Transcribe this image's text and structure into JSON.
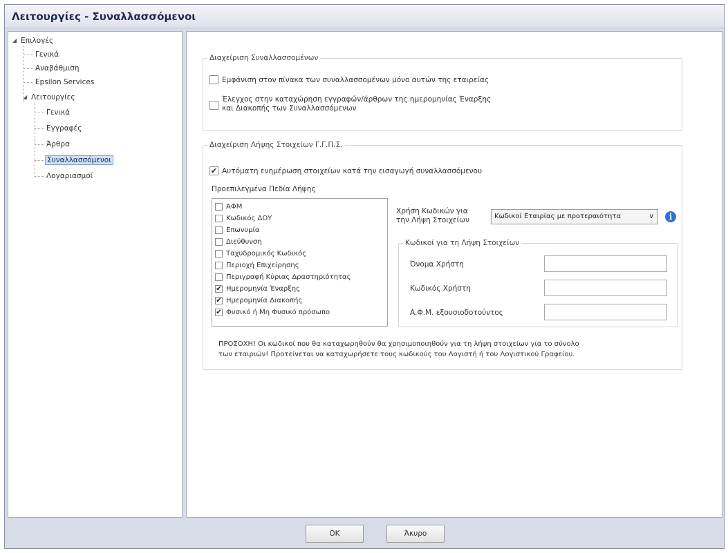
{
  "window": {
    "title": "Λειτουργίες - Συναλλασσόμενοι"
  },
  "tree": {
    "root": "Επιλογές",
    "items": [
      "Γενικά",
      "Αναβάθμιση",
      "Epsilon Services"
    ],
    "functions": "Λειτουργίες",
    "sub_items": [
      "Γενικά",
      "Εγγραφές",
      "Άρθρα",
      "Συναλλασσόμενοι",
      "Λογαριασμοί"
    ]
  },
  "group1": {
    "legend": "Διαχείριση Συναλλασσομένων",
    "options": [
      {
        "label": "Εμφάνιση στον πίνακα των συναλλασσομένων μόνο αυτών της εταιρείας",
        "checked": false
      },
      {
        "label_line1": "Έλεγχος στην καταχώρηση εγγραφών/άρθρων της ημερομηνίας Έναρξης",
        "label_line2": "και Διακοπής των Συναλλασσόμενων",
        "checked": false
      }
    ]
  },
  "group2": {
    "legend": "Διαχείριση Λήψης Στοιχείων Γ.Γ.Π.Σ.",
    "auto_update": {
      "label": "Αυτόματη ενημέρωση στοιχείων κατά την εισαγωγή συναλλασσόμενου",
      "checked": true
    },
    "default_fields_label": "Προεπιλεγμένα Πεδία Λήψης",
    "fields": [
      {
        "label": "ΑΦΜ",
        "checked": false
      },
      {
        "label": "Κωδικός ΔΟΥ",
        "checked": false
      },
      {
        "label": "Επωνυμία",
        "checked": false
      },
      {
        "label": "Διεύθυνση",
        "checked": false
      },
      {
        "label": "Ταχυδρομικός Κωδικός",
        "checked": false
      },
      {
        "label": "Περιοχή Επιχείρησης",
        "checked": false
      },
      {
        "label": "Περιγραφή Κύριας Δραστηριότητας",
        "checked": false
      },
      {
        "label": "Ημερομηνία Έναρξης",
        "checked": true
      },
      {
        "label": "Ημερομηνία Διακοπής",
        "checked": true
      },
      {
        "label": "Φυσικό ή Μη Φυσικό πρόσωπο",
        "checked": true
      }
    ],
    "codes_usage": {
      "label_line1": "Χρήση Κωδικών για",
      "label_line2": "την Λήψη Στοιχείων",
      "selected": "Κωδικοί Εταιρίας με προτεραιότητα",
      "arrow": "∨",
      "info": "i"
    },
    "codes_group": {
      "legend": "Κωδικοί για τη Λήψη Στοιχείων",
      "username_label": "Όνομα Χρήστη",
      "username_value": "",
      "password_label": "Κωδικός Χρήστη",
      "password_value": "",
      "afm_label": "Α.Φ.Μ. εξουσιοδοτούντος",
      "afm_value": ""
    },
    "note_line1": "ΠΡΟΣΟΧΗ! Οι κωδικοί που θα καταχωρηθούν θα χρησιμοποιηθούν για τη λήψη στοιχείων για το σύνολο",
    "note_line2": "των εταιριών! Προτείνεται να καταχωρήσετε τους κωδικούς του Λογιστή ή του Λογιστικού Γραφείου."
  },
  "footer": {
    "ok": "OK",
    "cancel": "Άκυρο"
  }
}
